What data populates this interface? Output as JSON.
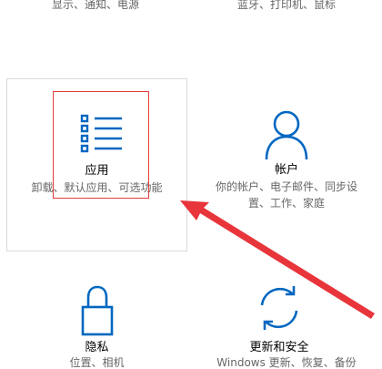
{
  "tiles": {
    "system": {
      "desc": "显示、通知、电源"
    },
    "devices": {
      "desc": "蓝牙、打印机、鼠标"
    },
    "apps": {
      "title": "应用",
      "desc": "卸载、默认应用、可选功能"
    },
    "accounts": {
      "title": "帐户",
      "desc": "你的帐户、电子邮件、同步设置、工作、家庭"
    },
    "privacy": {
      "title": "隐私",
      "desc": "位置、相机"
    },
    "update": {
      "title": "更新和安全",
      "desc": "Windows 更新、恢复、备份"
    }
  },
  "colors": {
    "icon_blue": "#0067c0",
    "highlight_red": "#e33b3b",
    "arrow_red": "#e8353b",
    "desc_gray": "#666666"
  },
  "icons": {
    "apps": "list-icon",
    "accounts": "person-icon",
    "privacy": "lock-icon",
    "update": "refresh-icon"
  }
}
